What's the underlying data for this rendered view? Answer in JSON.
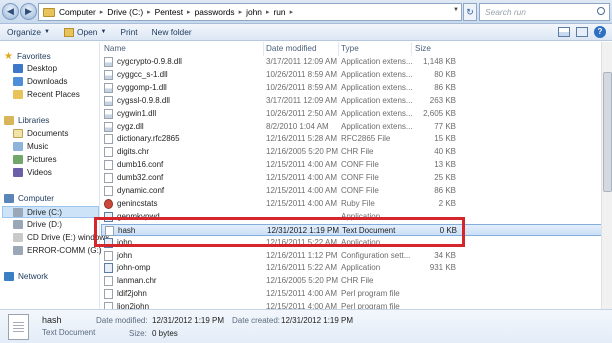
{
  "address": {
    "crumbs": [
      "Computer",
      "Drive (C:)",
      "Pentest",
      "passwords",
      "john",
      "run"
    ],
    "search_placeholder": "Search run"
  },
  "toolbar": {
    "organize": "Organize",
    "open": "Open",
    "print": "Print",
    "new_folder": "New folder"
  },
  "nav": {
    "favorites": "Favorites",
    "desktop": "Desktop",
    "downloads": "Downloads",
    "recent": "Recent Places",
    "libraries": "Libraries",
    "documents": "Documents",
    "music": "Music",
    "pictures": "Pictures",
    "videos": "Videos",
    "computer": "Computer",
    "drive_c": "Drive (C:)",
    "drive_d": "Drive (D:)",
    "cd_drive": "CD Drive (E:) windows",
    "error_comm": "ERROR-COMM (G:)",
    "network": "Network"
  },
  "columns": {
    "name": "Name",
    "date": "Date modified",
    "type": "Type",
    "size": "Size"
  },
  "files": [
    {
      "name": "cygcrypto-0.9.8.dll",
      "date": "3/17/2011 12:09 AM",
      "type": "Application extens...",
      "size": "1,148 KB",
      "icon": "dll"
    },
    {
      "name": "cyggcc_s-1.dll",
      "date": "10/26/2011 8:59 AM",
      "type": "Application extens...",
      "size": "80 KB",
      "icon": "dll"
    },
    {
      "name": "cyggomp-1.dll",
      "date": "10/26/2011 8:59 AM",
      "type": "Application extens...",
      "size": "86 KB",
      "icon": "dll"
    },
    {
      "name": "cygssl-0.9.8.dll",
      "date": "3/17/2011 12:09 AM",
      "type": "Application extens...",
      "size": "263 KB",
      "icon": "dll"
    },
    {
      "name": "cygwin1.dll",
      "date": "10/26/2011 2:50 AM",
      "type": "Application extens...",
      "size": "2,605 KB",
      "icon": "dll"
    },
    {
      "name": "cygz.dll",
      "date": "8/2/2010 1:04 AM",
      "type": "Application extens...",
      "size": "77 KB",
      "icon": "dll"
    },
    {
      "name": "dictionary.rfc2865",
      "date": "12/16/2011 5:28 AM",
      "type": "RFC2865 File",
      "size": "15 KB",
      "icon": "file"
    },
    {
      "name": "digits.chr",
      "date": "12/16/2005 5:20 PM",
      "type": "CHR File",
      "size": "40 KB",
      "icon": "file"
    },
    {
      "name": "dumb16.conf",
      "date": "12/15/2011 4:00 AM",
      "type": "CONF File",
      "size": "13 KB",
      "icon": "file"
    },
    {
      "name": "dumb32.conf",
      "date": "12/15/2011 4:00 AM",
      "type": "CONF File",
      "size": "25 KB",
      "icon": "file"
    },
    {
      "name": "dynamic.conf",
      "date": "12/15/2011 4:00 AM",
      "type": "CONF File",
      "size": "86 KB",
      "icon": "file"
    },
    {
      "name": "genincstats",
      "date": "12/15/2011 4:00 AM",
      "type": "Ruby File",
      "size": "2 KB",
      "icon": "rb"
    },
    {
      "name": "genmkvpwd",
      "date": "",
      "type": "Application",
      "size": "",
      "icon": "exe"
    },
    {
      "name": "hash",
      "date": "12/31/2012 1:19 PM",
      "type": "Text Document",
      "size": "0 KB",
      "icon": "file",
      "selected": true
    },
    {
      "name": "john",
      "date": "12/16/2011 5:22 AM",
      "type": "Application",
      "size": "",
      "icon": "exe"
    },
    {
      "name": "john",
      "date": "12/16/2011 1:12 PM",
      "type": "Configuration sett...",
      "size": "34 KB",
      "icon": "file"
    },
    {
      "name": "john-omp",
      "date": "12/16/2011 5:22 AM",
      "type": "Application",
      "size": "931 KB",
      "icon": "exe"
    },
    {
      "name": "lanman.chr",
      "date": "12/16/2005 5:20 PM",
      "type": "CHR File",
      "size": "",
      "icon": "file"
    },
    {
      "name": "ldif2john",
      "date": "12/15/2011 4:00 AM",
      "type": "Perl program file",
      "size": "",
      "icon": "file"
    },
    {
      "name": "lion2john",
      "date": "12/15/2011 4:00 AM",
      "type": "Perl program file",
      "size": "",
      "icon": "file"
    }
  ],
  "details": {
    "name": "hash",
    "type": "Text Document",
    "modified_label": "Date modified:",
    "modified_value": "12/31/2012 1:19 PM",
    "created_label": "Date created:",
    "created_value": "12/31/2012 1:19 PM",
    "size_label": "Size:",
    "size_value": "0 bytes"
  },
  "colors": {
    "highlight": "#d4262c",
    "selection": "#cadff7"
  }
}
